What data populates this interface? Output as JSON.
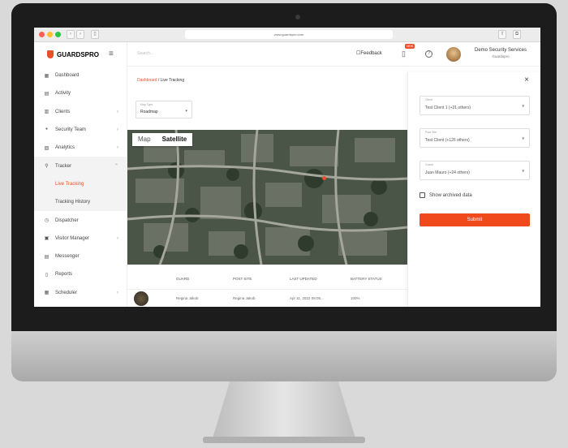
{
  "browser": {
    "url": "www.guardspro.com"
  },
  "brand": {
    "name": "GUARDSPRO",
    "accent": "#e8502a",
    "submit_color": "#f04a1c"
  },
  "sidebar": {
    "items": [
      {
        "label": "Dashboard",
        "icon": "grid-icon"
      },
      {
        "label": "Activity",
        "icon": "calendar-icon"
      },
      {
        "label": "Clients",
        "icon": "building-icon",
        "chevron": "›"
      },
      {
        "label": "Security Team",
        "icon": "people-icon",
        "chevron": "›"
      },
      {
        "label": "Analytics",
        "icon": "chart-icon",
        "chevron": "›"
      },
      {
        "label": "Tracker",
        "icon": "pin-icon",
        "chevron": "⌃"
      },
      {
        "label": "Dispatcher",
        "icon": "clock-icon"
      },
      {
        "label": "Visitor Manager",
        "icon": "id-card-icon",
        "chevron": "›"
      },
      {
        "label": "Messenger",
        "icon": "chat-icon"
      },
      {
        "label": "Reports",
        "icon": "document-icon"
      },
      {
        "label": "Scheduler",
        "icon": "calendar-icon",
        "chevron": "›"
      }
    ],
    "tracker_sub": [
      {
        "label": "Live Tracking",
        "active": true
      },
      {
        "label": "Tracking History",
        "active": false
      }
    ]
  },
  "topbar": {
    "search_placeholder": "Search...",
    "feedback_label": "Feedback",
    "notification_badge": "NEW",
    "company_name": "Demo Security Services",
    "company_sub": "Guardspro"
  },
  "breadcrumb": {
    "root": "Dashboard",
    "separator": " / ",
    "current": "Live Tracking"
  },
  "map_type": {
    "label": "Map Type",
    "value": "Roadmap",
    "arrow": "▾"
  },
  "map": {
    "tab_map": "Map",
    "tab_satellite": "Satellite"
  },
  "table": {
    "headers": [
      "GUARD",
      "POST SITE",
      "LAST UPDATED",
      "BATTERY STATUS"
    ],
    "rows": [
      {
        "guard": "Regina Jakob",
        "post_site": "Regina Jakob",
        "updated": "Apr 11, 2022 08:05...",
        "battery": "100%"
      }
    ]
  },
  "filter_panel": {
    "close": "×",
    "fields": [
      {
        "label": "Client",
        "value": "Test Client 1 (+31 others)"
      },
      {
        "label": "Post Site",
        "value": "Test Client (+126 others)"
      },
      {
        "label": "Guard",
        "value": "Juan Mauro (+24 others)"
      }
    ],
    "arrow": "▾",
    "archived_label": "Show archived data",
    "submit_label": "Submit"
  }
}
